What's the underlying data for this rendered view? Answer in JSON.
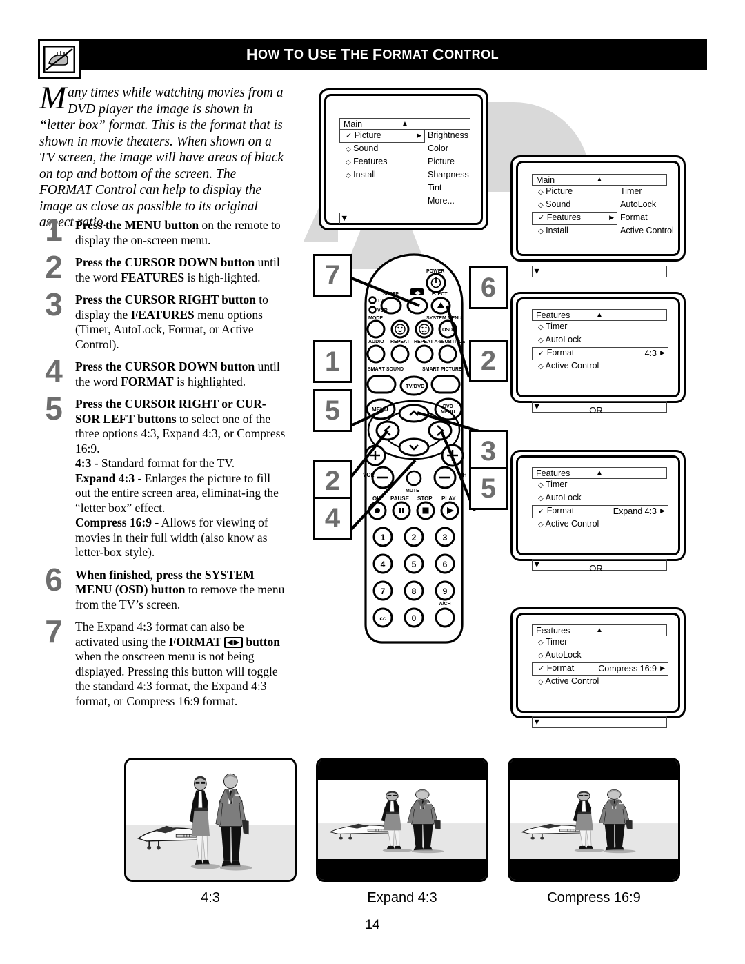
{
  "header": {
    "title_words": [
      {
        "cap": "H",
        "rest": "OW"
      },
      {
        "cap": "T",
        "rest": "O"
      },
      {
        "cap": "U",
        "rest": "SE"
      },
      {
        "cap": "T",
        "rest": "HE"
      },
      {
        "cap": "F",
        "rest": "ORMAT"
      },
      {
        "cap": "C",
        "rest": "ONTROL"
      }
    ],
    "title_plain": "HOW TO USE THE FORMAT CONTROL",
    "icon": "hand-pointing-icon"
  },
  "lead": {
    "dropcap": "M",
    "text": "any times while watching movies from a DVD player the image is shown in “letter box” format. This is the format that is shown in movie theaters. When shown on a TV screen, the image will have areas of black on top and bottom of the screen. The FORMAT Control can help to display the image as close as possible to its original aspect ratio."
  },
  "steps": [
    {
      "num": "1",
      "html": "<b>Press the MENU button</b> on the remote to display the on-screen menu."
    },
    {
      "num": "2",
      "html": "<b>Press the CURSOR DOWN button</b> until the word <b>FEATURES</b> is high-lighted."
    },
    {
      "num": "3",
      "html": "<b>Press the CURSOR RIGHT button</b> to display the <b>FEATURES</b> menu options (Timer, AutoLock, Format, or Active Control)."
    },
    {
      "num": "4",
      "html": "<b>Press the CURSOR DOWN button</b> until the word <b>FORMAT</b> is highlighted."
    },
    {
      "num": "5",
      "html": "<b>Press the CURSOR RIGHT or CUR-SOR LEFT buttons</b> to select one of the three options 4:3, Expand 4:3, or Compress 16:9.<br><b>4:3 -</b> Standard format for the TV.<br><b>Expand 4:3 -</b> Enlarges the picture to fill out the entire screen area, eliminat-ing the “letter box” effect.<br><b>Compress 16:9 -</b> Allows for viewing of movies in their full width (also know as letter-box style)."
    },
    {
      "num": "6",
      "html": "<b>When finished, press the SYSTEM MENU (OSD) button</b> to remove the menu from the TV’s screen."
    },
    {
      "num": "7",
      "html": "The Expand 4:3 format can also be activated using the <b>FORMAT <span class=\"fmtglyph\">◀▶</span> button</b> when the onscreen menu is not being displayed. Pressing this button will toggle the standard 4:3 format, the Expand 4:3 format, or Compress 16:9 format."
    }
  ],
  "osd_screens": [
    {
      "id": "main-picture",
      "title": "Main",
      "up_arrow": "▲",
      "down_arrow": "▼",
      "left_items": [
        {
          "label": "Picture",
          "marker": "check",
          "selected": true,
          "arrow": "▶"
        },
        {
          "label": "Sound",
          "marker": "diamond",
          "selected": false
        },
        {
          "label": "Features",
          "marker": "diamond",
          "selected": false
        },
        {
          "label": "Install",
          "marker": "diamond",
          "selected": false
        }
      ],
      "right_items": [
        "Brightness",
        "Color",
        "Picture",
        "Sharpness",
        "Tint",
        "More..."
      ]
    },
    {
      "id": "main-features",
      "title": "Main",
      "up_arrow": "▲",
      "down_arrow": "▼",
      "left_items": [
        {
          "label": "Picture",
          "marker": "diamond",
          "selected": false
        },
        {
          "label": "Sound",
          "marker": "diamond",
          "selected": false
        },
        {
          "label": "Features",
          "marker": "check",
          "selected": true,
          "arrow": "▶"
        },
        {
          "label": "Install",
          "marker": "diamond",
          "selected": false
        }
      ],
      "right_items": [
        "Timer",
        "AutoLock",
        "Format",
        "Active Control"
      ]
    },
    {
      "id": "features-43",
      "title": "Features",
      "up_arrow": "▲",
      "down_arrow": "▼",
      "left_items": [
        {
          "label": "Timer",
          "marker": "diamond",
          "selected": false
        },
        {
          "label": "AutoLock",
          "marker": "diamond",
          "selected": false
        },
        {
          "label": "Format",
          "marker": "check",
          "selected": true,
          "value": "4:3",
          "arrow": "▶"
        },
        {
          "label": "Active Control",
          "marker": "diamond",
          "selected": false
        }
      ],
      "right_items": []
    },
    {
      "id": "features-expand43",
      "title": "Features",
      "up_arrow": "▲",
      "down_arrow": "▼",
      "left_items": [
        {
          "label": "Timer",
          "marker": "diamond",
          "selected": false
        },
        {
          "label": "AutoLock",
          "marker": "diamond",
          "selected": false
        },
        {
          "label": "Format",
          "marker": "check",
          "selected": true,
          "value": "Expand 4:3",
          "arrow": "▶"
        },
        {
          "label": "Active Control",
          "marker": "diamond",
          "selected": false
        }
      ],
      "right_items": []
    },
    {
      "id": "features-compress169",
      "title": "Features",
      "up_arrow": "▲",
      "down_arrow": "▼",
      "left_items": [
        {
          "label": "Timer",
          "marker": "diamond",
          "selected": false
        },
        {
          "label": "AutoLock",
          "marker": "diamond",
          "selected": false
        },
        {
          "label": "Format",
          "marker": "check",
          "selected": true,
          "value": "Compress 16:9",
          "arrow": "▶"
        },
        {
          "label": "Active Control",
          "marker": "diamond",
          "selected": false
        }
      ],
      "right_items": []
    }
  ],
  "or_labels": [
    "OR",
    "OR"
  ],
  "remote": {
    "labels": {
      "power": "POWER",
      "sleep": "SLEEP",
      "format": "FORMAT",
      "eject": "EJECT",
      "tv": "TV",
      "vcr": "VCR",
      "mode": "MODE",
      "system_menu": "SYSTEM MENU",
      "osd": "OSD",
      "audio": "AUDIO",
      "repeat": "REPEAT",
      "repeat_ab": "REPEAT A-B",
      "subtitle": "SUBTITLE",
      "smart_sound": "SMART SOUND",
      "smart_picture": "SMART PICTURE",
      "tv_dvd": "TV/DVD",
      "menu": "MENU",
      "dvd_menu": "DVD MENU",
      "vol": "VOL",
      "ch": "CH",
      "mute": "MUTE",
      "ok": "OK",
      "pause": "PAUSE",
      "stop": "STOP",
      "play": "PLAY",
      "cc": "cc",
      "ach": "A/CH"
    },
    "keypad": [
      "1",
      "2",
      "3",
      "4",
      "5",
      "6",
      "7",
      "8",
      "9",
      "cc",
      "0",
      ""
    ]
  },
  "callouts": {
    "left": [
      "7",
      "1",
      "5",
      "2",
      "4"
    ],
    "right": [
      "6",
      "2",
      "3",
      "5"
    ]
  },
  "samples": [
    {
      "caption": "4:3",
      "band": 0
    },
    {
      "caption": "Expand 4:3",
      "band": 30
    },
    {
      "caption": "Compress 16:9",
      "band": 30
    }
  ],
  "page_number": "14"
}
